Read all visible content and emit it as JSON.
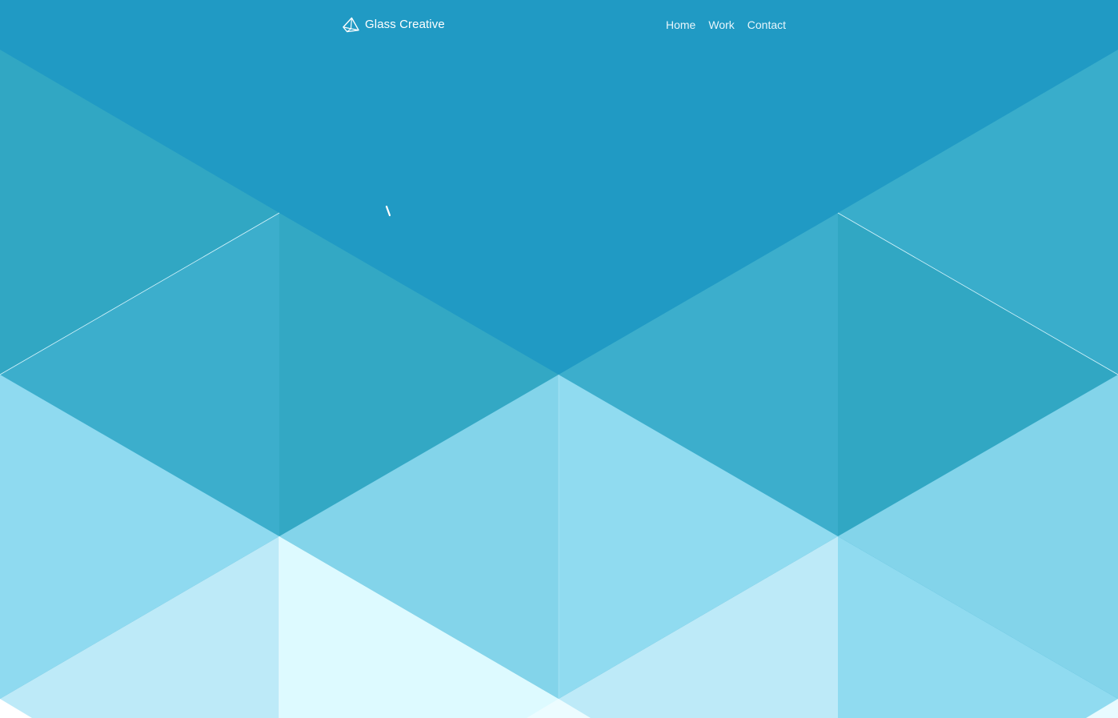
{
  "brand": {
    "name": "Glass Creative",
    "icon": "pyramid-logo-icon"
  },
  "nav": {
    "items": [
      {
        "label": "Home"
      },
      {
        "label": "Work"
      },
      {
        "label": "Contact"
      }
    ]
  },
  "hero": {
    "loader_icon": "loading-spinner-icon"
  },
  "colors": {
    "background": "#209ac4",
    "mid_left": "#31a7c3",
    "mid_right": "#3caecc",
    "light_band": "#85d4ea",
    "pale": "#bdeaf8",
    "brightest": "#ddfaff",
    "line": "#dff8ff",
    "text": "#ffffff"
  }
}
